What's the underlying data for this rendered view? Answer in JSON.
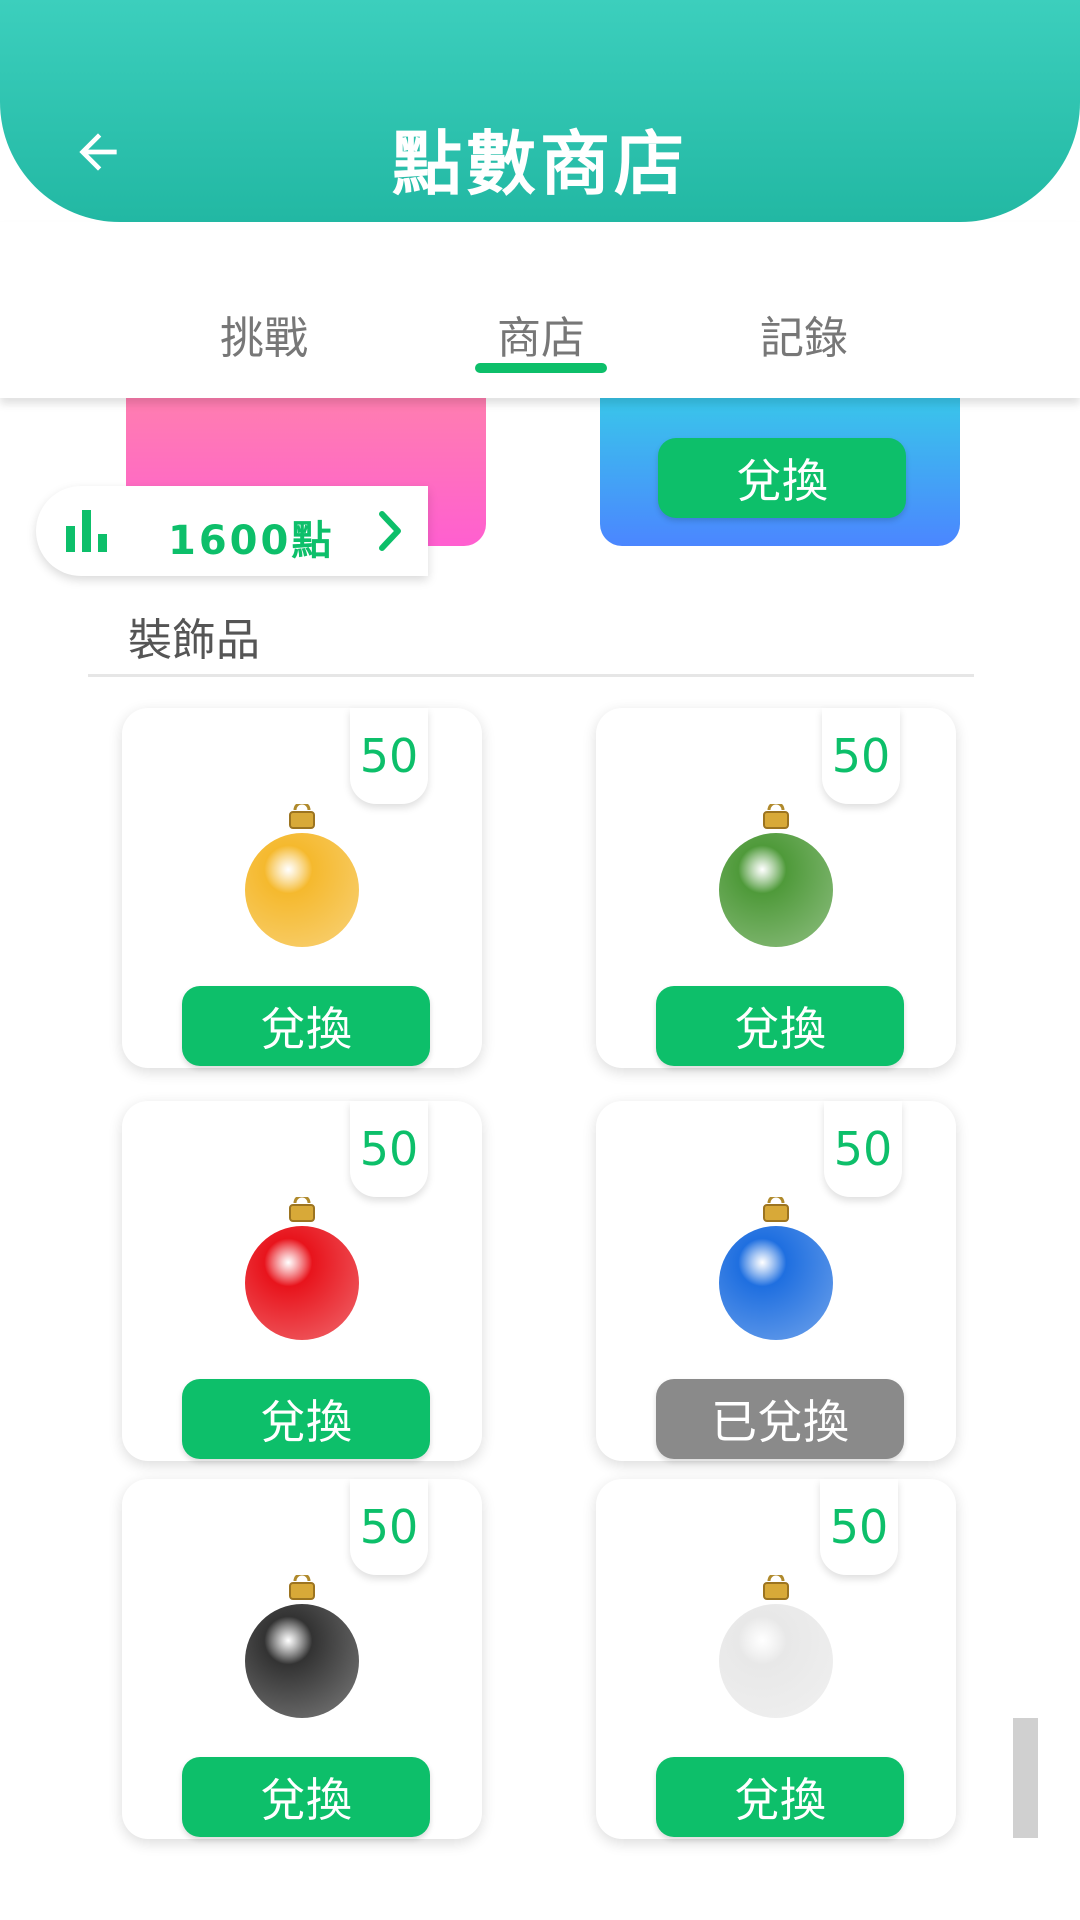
{
  "header": {
    "title": "點數商店",
    "back_icon": "arrow-left-icon"
  },
  "tabs": [
    {
      "label": "挑戰",
      "active": false
    },
    {
      "label": "商店",
      "active": true
    },
    {
      "label": "記錄",
      "active": false
    }
  ],
  "top_cards": [
    {
      "color": "#ff6fc0"
    },
    {
      "color": "#4a90ff",
      "button_label": "兌換"
    }
  ],
  "points": {
    "text": "1600點",
    "icon": "bar-chart-icon",
    "chevron": "chevron-right-icon"
  },
  "section": {
    "title": "裝飾品"
  },
  "items": [
    {
      "price": "50",
      "ornament_color": "#f5b92e",
      "button_label": "兌換",
      "redeemed": false
    },
    {
      "price": "50",
      "ornament_color": "#4f9a3a",
      "button_label": "兌換",
      "redeemed": false
    },
    {
      "price": "50",
      "ornament_color": "#e8141c",
      "button_label": "兌換",
      "redeemed": false
    },
    {
      "price": "50",
      "ornament_color": "#1f6fe0",
      "button_label": "已兌換",
      "redeemed": true
    },
    {
      "price": "50",
      "ornament_color": "#333333",
      "button_label": "兌換",
      "redeemed": false
    },
    {
      "price": "50",
      "ornament_color": "#e8e8e8",
      "button_label": "兌換",
      "redeemed": false
    }
  ],
  "colors": {
    "accent": "#0dbf6a",
    "header": "#2ec4b0",
    "redeemed": "#8a8a8a"
  }
}
